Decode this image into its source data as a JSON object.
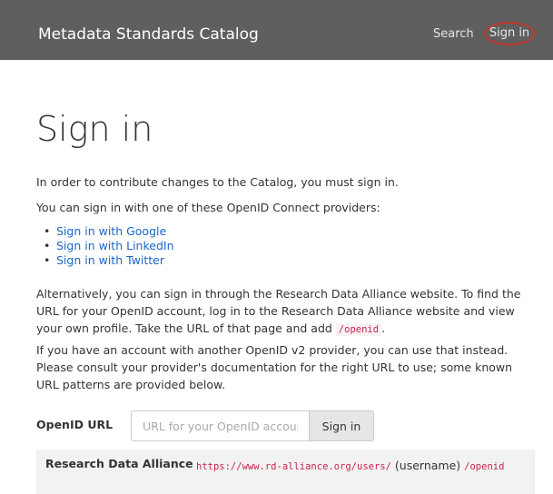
{
  "nav": {
    "brand": "Metadata Standards Catalog",
    "search": "Search",
    "signin": "Sign in"
  },
  "page": {
    "title": "Sign in",
    "intro": "In order to contribute changes to the Catalog, you must sign in.",
    "providers_intro": "You can sign in with one of these OpenID Connect providers:",
    "providers": [
      {
        "label": "Sign in with Google"
      },
      {
        "label": "Sign in with LinkedIn"
      },
      {
        "label": "Sign in with Twitter"
      }
    ],
    "alt_text": "Alternatively, you can sign in through the Research Data Alliance website. To find the URL for your OpenID account, log in to the Research Data Alliance website and view your own profile. Take the URL of that page and add",
    "alt_code": "/openid",
    "alt_end": ".",
    "openid_text": "If you have an account with another OpenID v2 provider, you can use that instead. Please consult your provider's documentation for the right URL to use; some known URL patterns are provided below."
  },
  "form": {
    "label": "OpenID URL",
    "placeholder": "URL for your OpenID account",
    "button": "Sign in"
  },
  "url_patterns": [
    {
      "name": "Research Data Alliance",
      "prefix": "https://www.rd-alliance.org/users/",
      "middle": "(username)",
      "suffix": "/openid"
    }
  ],
  "colors": {
    "navbar": "#5f5f5f",
    "link": "#1a66c8",
    "code": "#c7254e",
    "highlight_circle": "#c0392b"
  }
}
